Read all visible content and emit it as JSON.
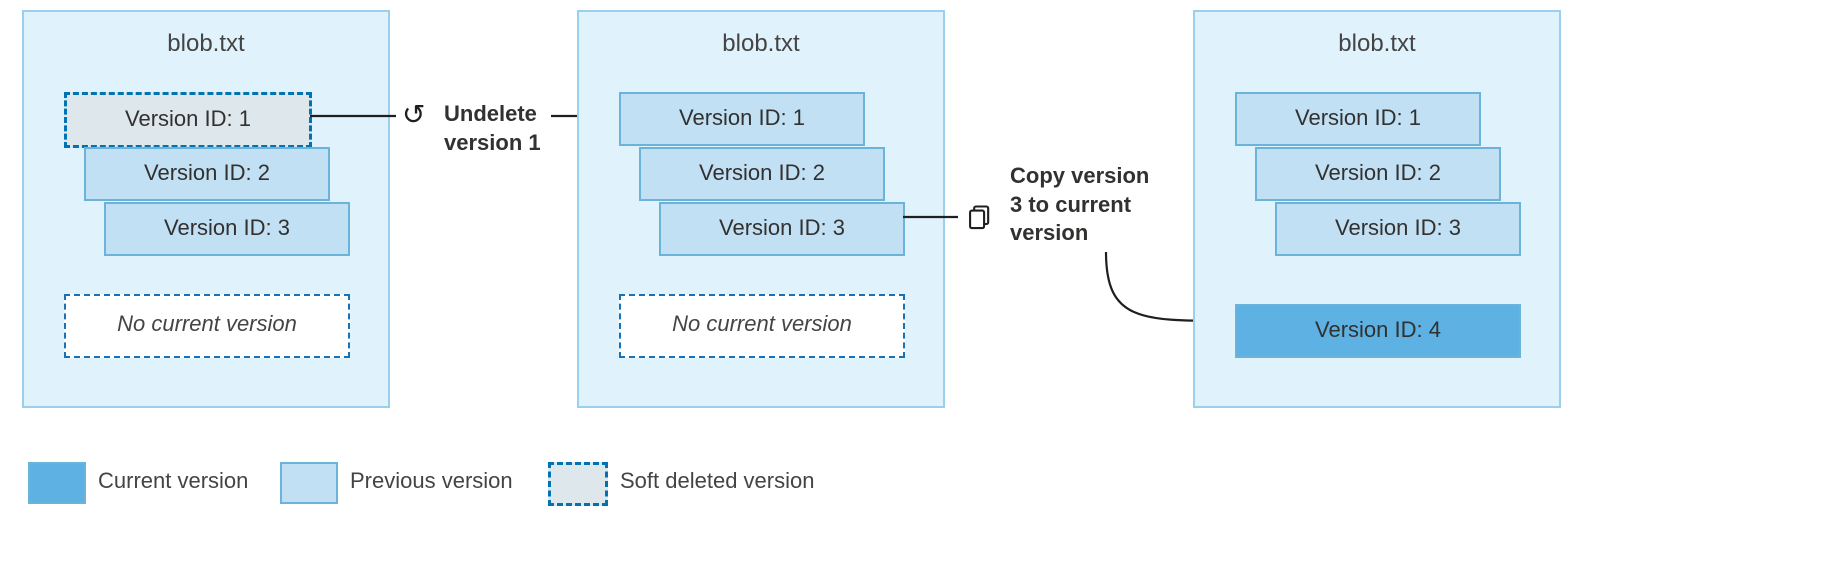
{
  "panel1": {
    "title": "blob.txt",
    "versions": {
      "v1": "Version ID: 1",
      "v2": "Version ID: 2",
      "v3": "Version ID: 3"
    },
    "no_current": "No current version"
  },
  "action1": {
    "line1": "Undelete",
    "line2": "version 1"
  },
  "panel2": {
    "title": "blob.txt",
    "versions": {
      "v1": "Version ID: 1",
      "v2": "Version ID: 2",
      "v3": "Version ID: 3"
    },
    "no_current": "No current version"
  },
  "action2": {
    "line1": "Copy version",
    "line2": "3 to current",
    "line3": "version"
  },
  "panel3": {
    "title": "blob.txt",
    "versions": {
      "v1": "Version ID: 1",
      "v2": "Version ID: 2",
      "v3": "Version ID: 3",
      "v4": "Version ID: 4"
    }
  },
  "legend": {
    "current": "Current version",
    "previous": "Previous version",
    "soft_deleted": "Soft deleted version"
  }
}
